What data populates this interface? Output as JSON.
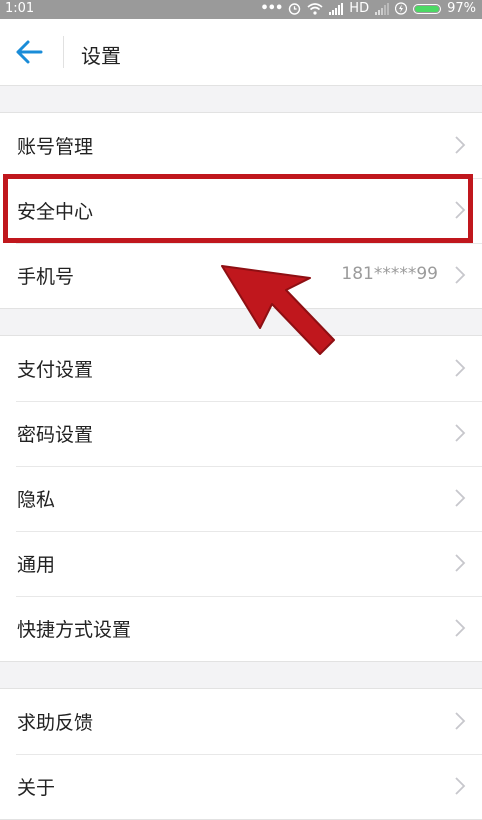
{
  "status_bar": {
    "time": "1:01",
    "network": "HD",
    "battery": "97%",
    "icons": [
      "more-dots-icon",
      "alarm-icon",
      "wifi-icon",
      "signal-icon",
      "charging-icon",
      "battery-icon"
    ]
  },
  "header": {
    "title": "设置",
    "back_icon": "back-arrow-icon"
  },
  "sections": [
    {
      "items": [
        {
          "label": "账号管理",
          "value": ""
        },
        {
          "label": "安全中心",
          "value": "",
          "highlighted": true
        },
        {
          "label": "手机号",
          "value": "181*****99"
        }
      ]
    },
    {
      "items": [
        {
          "label": "支付设置",
          "value": ""
        },
        {
          "label": "密码设置",
          "value": ""
        },
        {
          "label": "隐私",
          "value": ""
        },
        {
          "label": "通用",
          "value": ""
        },
        {
          "label": "快捷方式设置",
          "value": ""
        }
      ]
    },
    {
      "items": [
        {
          "label": "求助反馈",
          "value": ""
        },
        {
          "label": "关于",
          "value": ""
        }
      ]
    }
  ],
  "colors": {
    "accent": "#1a8cd8",
    "annotation": "#c0171d",
    "background": "#f3f3f5"
  }
}
